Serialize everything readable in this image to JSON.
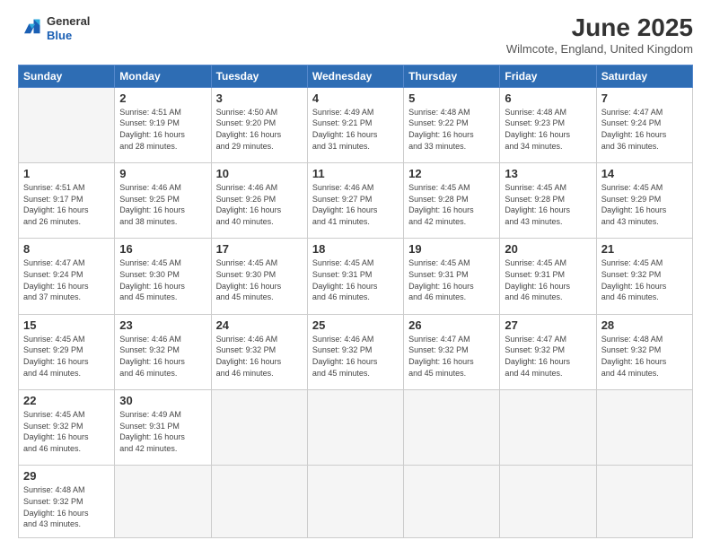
{
  "header": {
    "logo": {
      "general": "General",
      "blue": "Blue"
    },
    "title": "June 2025",
    "subtitle": "Wilmcote, England, United Kingdom"
  },
  "calendar": {
    "days_of_week": [
      "Sunday",
      "Monday",
      "Tuesday",
      "Wednesday",
      "Thursday",
      "Friday",
      "Saturday"
    ],
    "weeks": [
      [
        {
          "day": "",
          "info": ""
        },
        {
          "day": "2",
          "info": "Sunrise: 4:51 AM\nSunset: 9:19 PM\nDaylight: 16 hours\nand 28 minutes."
        },
        {
          "day": "3",
          "info": "Sunrise: 4:50 AM\nSunset: 9:20 PM\nDaylight: 16 hours\nand 29 minutes."
        },
        {
          "day": "4",
          "info": "Sunrise: 4:49 AM\nSunset: 9:21 PM\nDaylight: 16 hours\nand 31 minutes."
        },
        {
          "day": "5",
          "info": "Sunrise: 4:48 AM\nSunset: 9:22 PM\nDaylight: 16 hours\nand 33 minutes."
        },
        {
          "day": "6",
          "info": "Sunrise: 4:48 AM\nSunset: 9:23 PM\nDaylight: 16 hours\nand 34 minutes."
        },
        {
          "day": "7",
          "info": "Sunrise: 4:47 AM\nSunset: 9:24 PM\nDaylight: 16 hours\nand 36 minutes."
        }
      ],
      [
        {
          "day": "1",
          "info": "Sunrise: 4:51 AM\nSunset: 9:17 PM\nDaylight: 16 hours\nand 26 minutes."
        },
        {
          "day": "9",
          "info": "Sunrise: 4:46 AM\nSunset: 9:25 PM\nDaylight: 16 hours\nand 38 minutes."
        },
        {
          "day": "10",
          "info": "Sunrise: 4:46 AM\nSunset: 9:26 PM\nDaylight: 16 hours\nand 40 minutes."
        },
        {
          "day": "11",
          "info": "Sunrise: 4:46 AM\nSunset: 9:27 PM\nDaylight: 16 hours\nand 41 minutes."
        },
        {
          "day": "12",
          "info": "Sunrise: 4:45 AM\nSunset: 9:28 PM\nDaylight: 16 hours\nand 42 minutes."
        },
        {
          "day": "13",
          "info": "Sunrise: 4:45 AM\nSunset: 9:28 PM\nDaylight: 16 hours\nand 43 minutes."
        },
        {
          "day": "14",
          "info": "Sunrise: 4:45 AM\nSunset: 9:29 PM\nDaylight: 16 hours\nand 43 minutes."
        }
      ],
      [
        {
          "day": "8",
          "info": "Sunrise: 4:47 AM\nSunset: 9:24 PM\nDaylight: 16 hours\nand 37 minutes."
        },
        {
          "day": "16",
          "info": "Sunrise: 4:45 AM\nSunset: 9:30 PM\nDaylight: 16 hours\nand 45 minutes."
        },
        {
          "day": "17",
          "info": "Sunrise: 4:45 AM\nSunset: 9:30 PM\nDaylight: 16 hours\nand 45 minutes."
        },
        {
          "day": "18",
          "info": "Sunrise: 4:45 AM\nSunset: 9:31 PM\nDaylight: 16 hours\nand 46 minutes."
        },
        {
          "day": "19",
          "info": "Sunrise: 4:45 AM\nSunset: 9:31 PM\nDaylight: 16 hours\nand 46 minutes."
        },
        {
          "day": "20",
          "info": "Sunrise: 4:45 AM\nSunset: 9:31 PM\nDaylight: 16 hours\nand 46 minutes."
        },
        {
          "day": "21",
          "info": "Sunrise: 4:45 AM\nSunset: 9:32 PM\nDaylight: 16 hours\nand 46 minutes."
        }
      ],
      [
        {
          "day": "15",
          "info": "Sunrise: 4:45 AM\nSunset: 9:29 PM\nDaylight: 16 hours\nand 44 minutes."
        },
        {
          "day": "23",
          "info": "Sunrise: 4:46 AM\nSunset: 9:32 PM\nDaylight: 16 hours\nand 46 minutes."
        },
        {
          "day": "24",
          "info": "Sunrise: 4:46 AM\nSunset: 9:32 PM\nDaylight: 16 hours\nand 46 minutes."
        },
        {
          "day": "25",
          "info": "Sunrise: 4:46 AM\nSunset: 9:32 PM\nDaylight: 16 hours\nand 45 minutes."
        },
        {
          "day": "26",
          "info": "Sunrise: 4:47 AM\nSunset: 9:32 PM\nDaylight: 16 hours\nand 45 minutes."
        },
        {
          "day": "27",
          "info": "Sunrise: 4:47 AM\nSunset: 9:32 PM\nDaylight: 16 hours\nand 44 minutes."
        },
        {
          "day": "28",
          "info": "Sunrise: 4:48 AM\nSunset: 9:32 PM\nDaylight: 16 hours\nand 44 minutes."
        }
      ],
      [
        {
          "day": "22",
          "info": "Sunrise: 4:45 AM\nSunset: 9:32 PM\nDaylight: 16 hours\nand 46 minutes."
        },
        {
          "day": "30",
          "info": "Sunrise: 4:49 AM\nSunset: 9:31 PM\nDaylight: 16 hours\nand 42 minutes."
        },
        {
          "day": "",
          "info": ""
        },
        {
          "day": "",
          "info": ""
        },
        {
          "day": "",
          "info": ""
        },
        {
          "day": "",
          "info": ""
        },
        {
          "day": "",
          "info": ""
        }
      ],
      [
        {
          "day": "29",
          "info": "Sunrise: 4:48 AM\nSunset: 9:32 PM\nDaylight: 16 hours\nand 43 minutes."
        },
        {
          "day": "",
          "info": ""
        },
        {
          "day": "",
          "info": ""
        },
        {
          "day": "",
          "info": ""
        },
        {
          "day": "",
          "info": ""
        },
        {
          "day": "",
          "info": ""
        },
        {
          "day": "",
          "info": ""
        }
      ]
    ]
  }
}
